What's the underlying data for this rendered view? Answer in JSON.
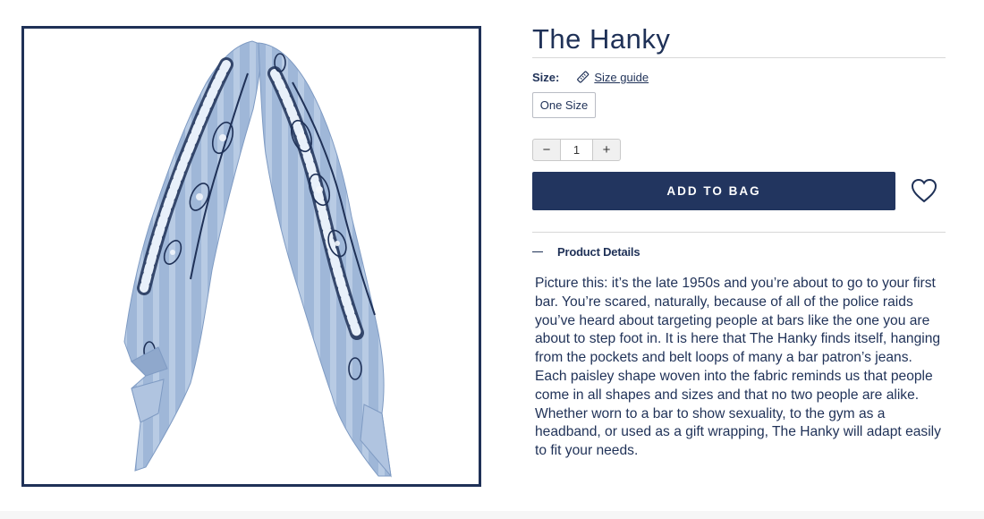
{
  "product": {
    "title": "The Hanky",
    "image_alt": "The Hanky paisley bandana"
  },
  "size": {
    "label": "Size:",
    "guide_label": "Size guide",
    "selected_option": "One Size"
  },
  "quantity": {
    "decrement_label": "−",
    "value": "1",
    "increment_label": "+"
  },
  "actions": {
    "add_to_bag_label": "ADD TO BAG",
    "wishlist_icon": "heart-icon"
  },
  "details": {
    "toggle_icon": "minus-icon",
    "title": "Product Details",
    "description": "Picture this: it’s the late 1950s and you’re about to go to your first bar. You’re scared, naturally, because of all of the police raids you’ve heard about targeting people at bars like the one you are about to step foot in. It is here that The Hanky finds itself, hanging from the pockets and belt loops of many a bar patron’s jeans. Each paisley shape woven into the fabric reminds us that people come in all shapes and sizes and that no two people are alike. Whether worn to a bar to show sexuality, to the gym as a headband, or used as a gift wrapping, The Hanky will adapt easily to fit your needs."
  },
  "colors": {
    "navy": "#1f3157",
    "button": "#22355f",
    "bandana_light": "#a9bfdc",
    "bandana_mid": "#7f9bc3"
  }
}
